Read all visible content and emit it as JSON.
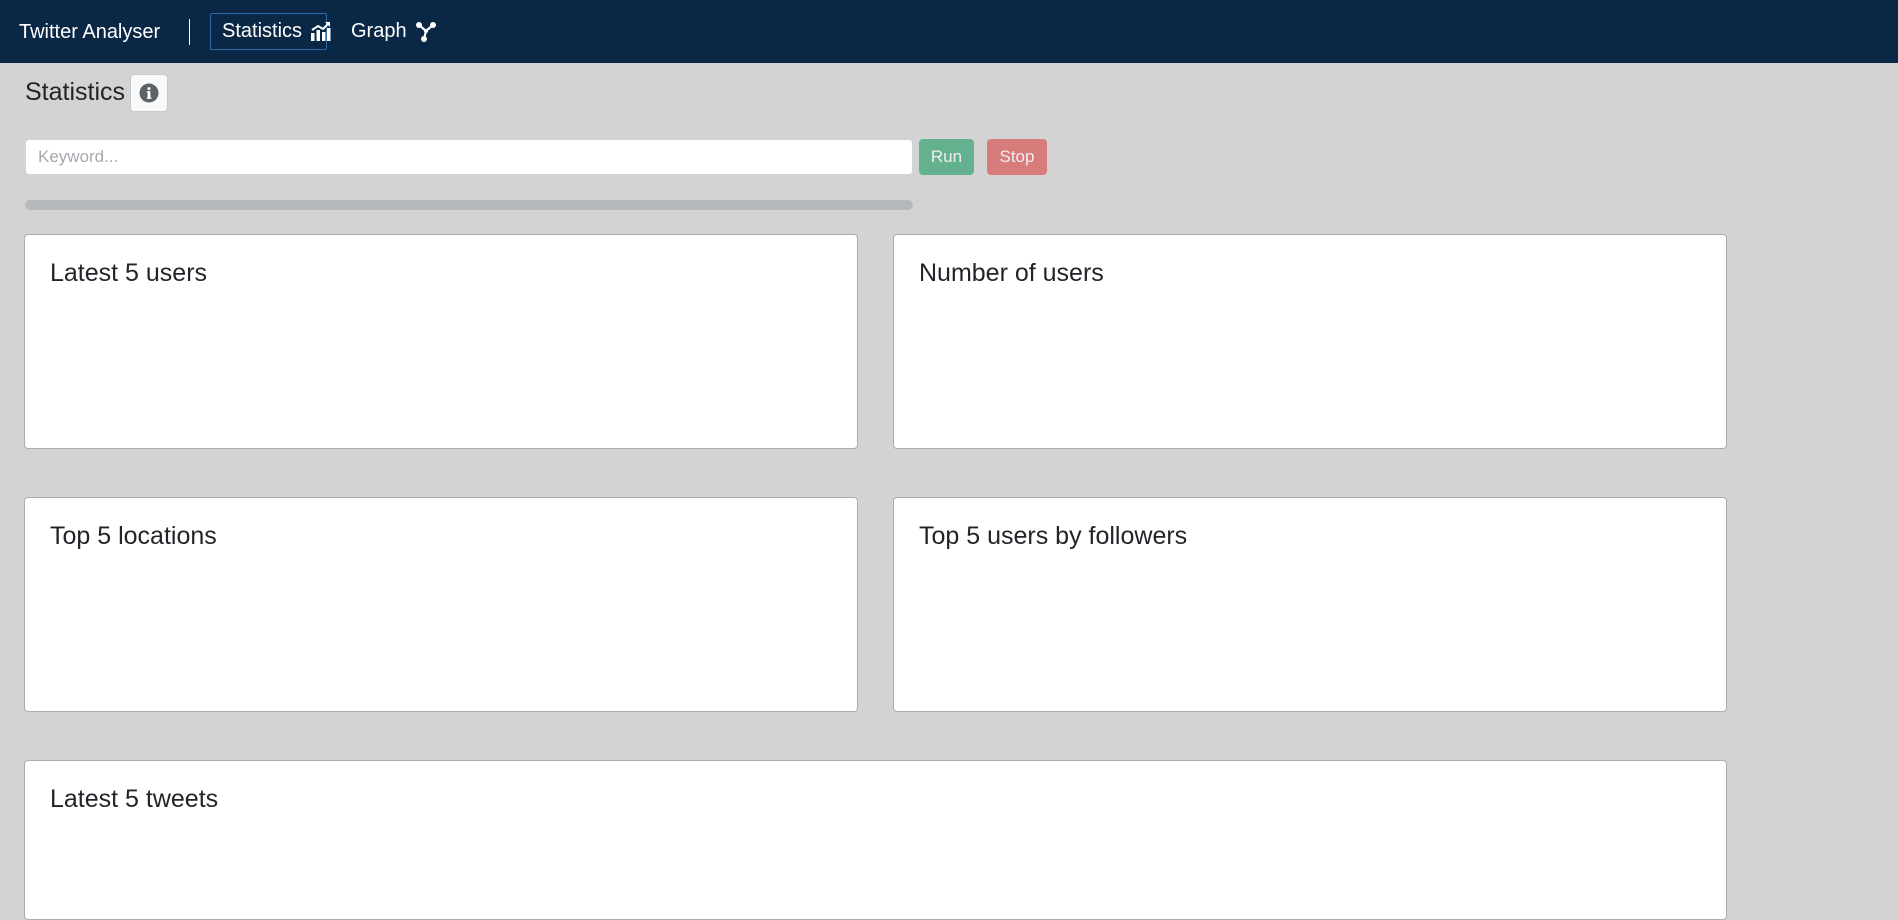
{
  "app": {
    "brand": "Twitter Analyser"
  },
  "nav": {
    "items": [
      {
        "label": "Statistics",
        "icon": "chart-icon",
        "active": true
      },
      {
        "label": "Graph",
        "icon": "graph-icon",
        "active": false
      }
    ]
  },
  "page": {
    "title": "Statistics"
  },
  "search": {
    "placeholder": "Keyword...",
    "value": ""
  },
  "buttons": {
    "run": "Run",
    "stop": "Stop"
  },
  "progress": {
    "value": 0
  },
  "cards": {
    "latest_users": "Latest 5 users",
    "number_of_users": "Number of users",
    "top_locations": "Top 5 locations",
    "top_users_followers": "Top 5 users by followers",
    "latest_tweets": "Latest 5 tweets"
  },
  "colors": {
    "navbar": "#0b2746",
    "background": "#d3d3d3",
    "run": "#28a06a",
    "stop": "#dc4d4d"
  }
}
